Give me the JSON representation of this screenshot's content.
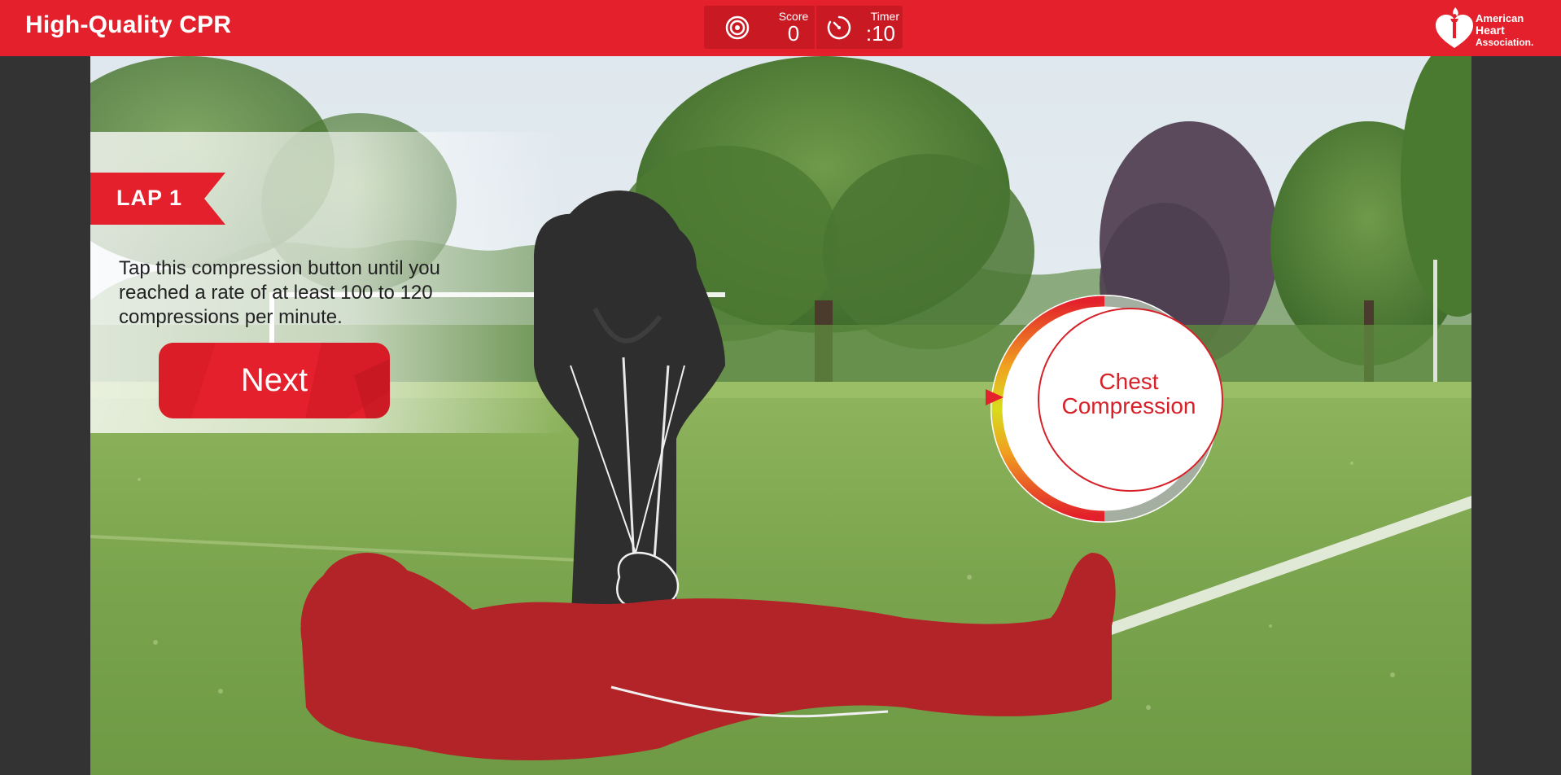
{
  "header": {
    "title": "High-Quality CPR",
    "score_label": "Score",
    "score_value": "0",
    "timer_label": "Timer",
    "timer_value": ":10",
    "logo_line1": "American",
    "logo_line2": "Heart",
    "logo_line3": "Association."
  },
  "lesson": {
    "lap_label": "LAP 1",
    "instructions": "Tap this compression button until you reached a rate of at least 100 to 120 compressions per minute.",
    "next_label": "Next"
  },
  "compression_button": {
    "label_line1": "Chest",
    "label_line2": "Compression"
  },
  "icons": {
    "score": "target-icon",
    "timer": "stopwatch-icon",
    "logo": "heart-torch-icon",
    "rate_marker": "triangle-pointer-icon"
  },
  "colors": {
    "brand_red": "#e3202b",
    "hud_red": "#c91a24",
    "victim_red": "#b22427",
    "rescuer": "#2e2e2e",
    "grass": "#7ea653",
    "sky": "#e3ebef"
  }
}
